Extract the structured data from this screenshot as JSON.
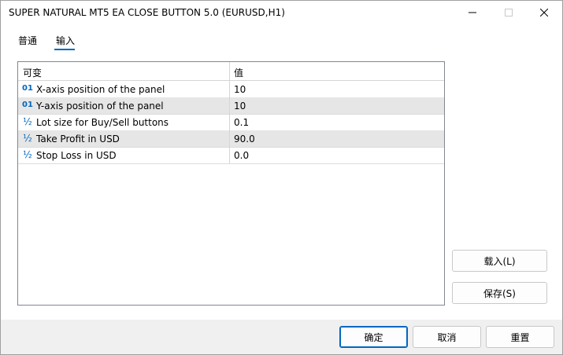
{
  "window": {
    "title": "SUPER NATURAL MT5 EA CLOSE BUTTON 5.0 (EURUSD,H1)"
  },
  "tabs": [
    {
      "label": "普通",
      "active": false
    },
    {
      "label": "输入",
      "active": true
    }
  ],
  "grid": {
    "headers": {
      "variable": "可变",
      "value": "值"
    },
    "rows": [
      {
        "icon": "01",
        "icon_name": "integer-icon",
        "name": "X-axis position of the panel",
        "value": "10"
      },
      {
        "icon": "01",
        "icon_name": "integer-icon",
        "name": "Y-axis position of the panel",
        "value": "10"
      },
      {
        "icon": "½",
        "icon_name": "fraction-icon",
        "name": "Lot size for Buy/Sell buttons",
        "value": "0.1"
      },
      {
        "icon": "½",
        "icon_name": "fraction-icon",
        "name": "Take Profit in USD",
        "value": "90.0"
      },
      {
        "icon": "½",
        "icon_name": "fraction-icon",
        "name": "Stop Loss in USD",
        "value": "0.0"
      }
    ]
  },
  "side_buttons": {
    "load": "载入(L)",
    "save": "保存(S)"
  },
  "footer_buttons": {
    "ok": "确定",
    "cancel": "取消",
    "reset": "重置"
  },
  "colors": {
    "accent": "#0067c0",
    "alt_row": "#e6e6e6"
  }
}
